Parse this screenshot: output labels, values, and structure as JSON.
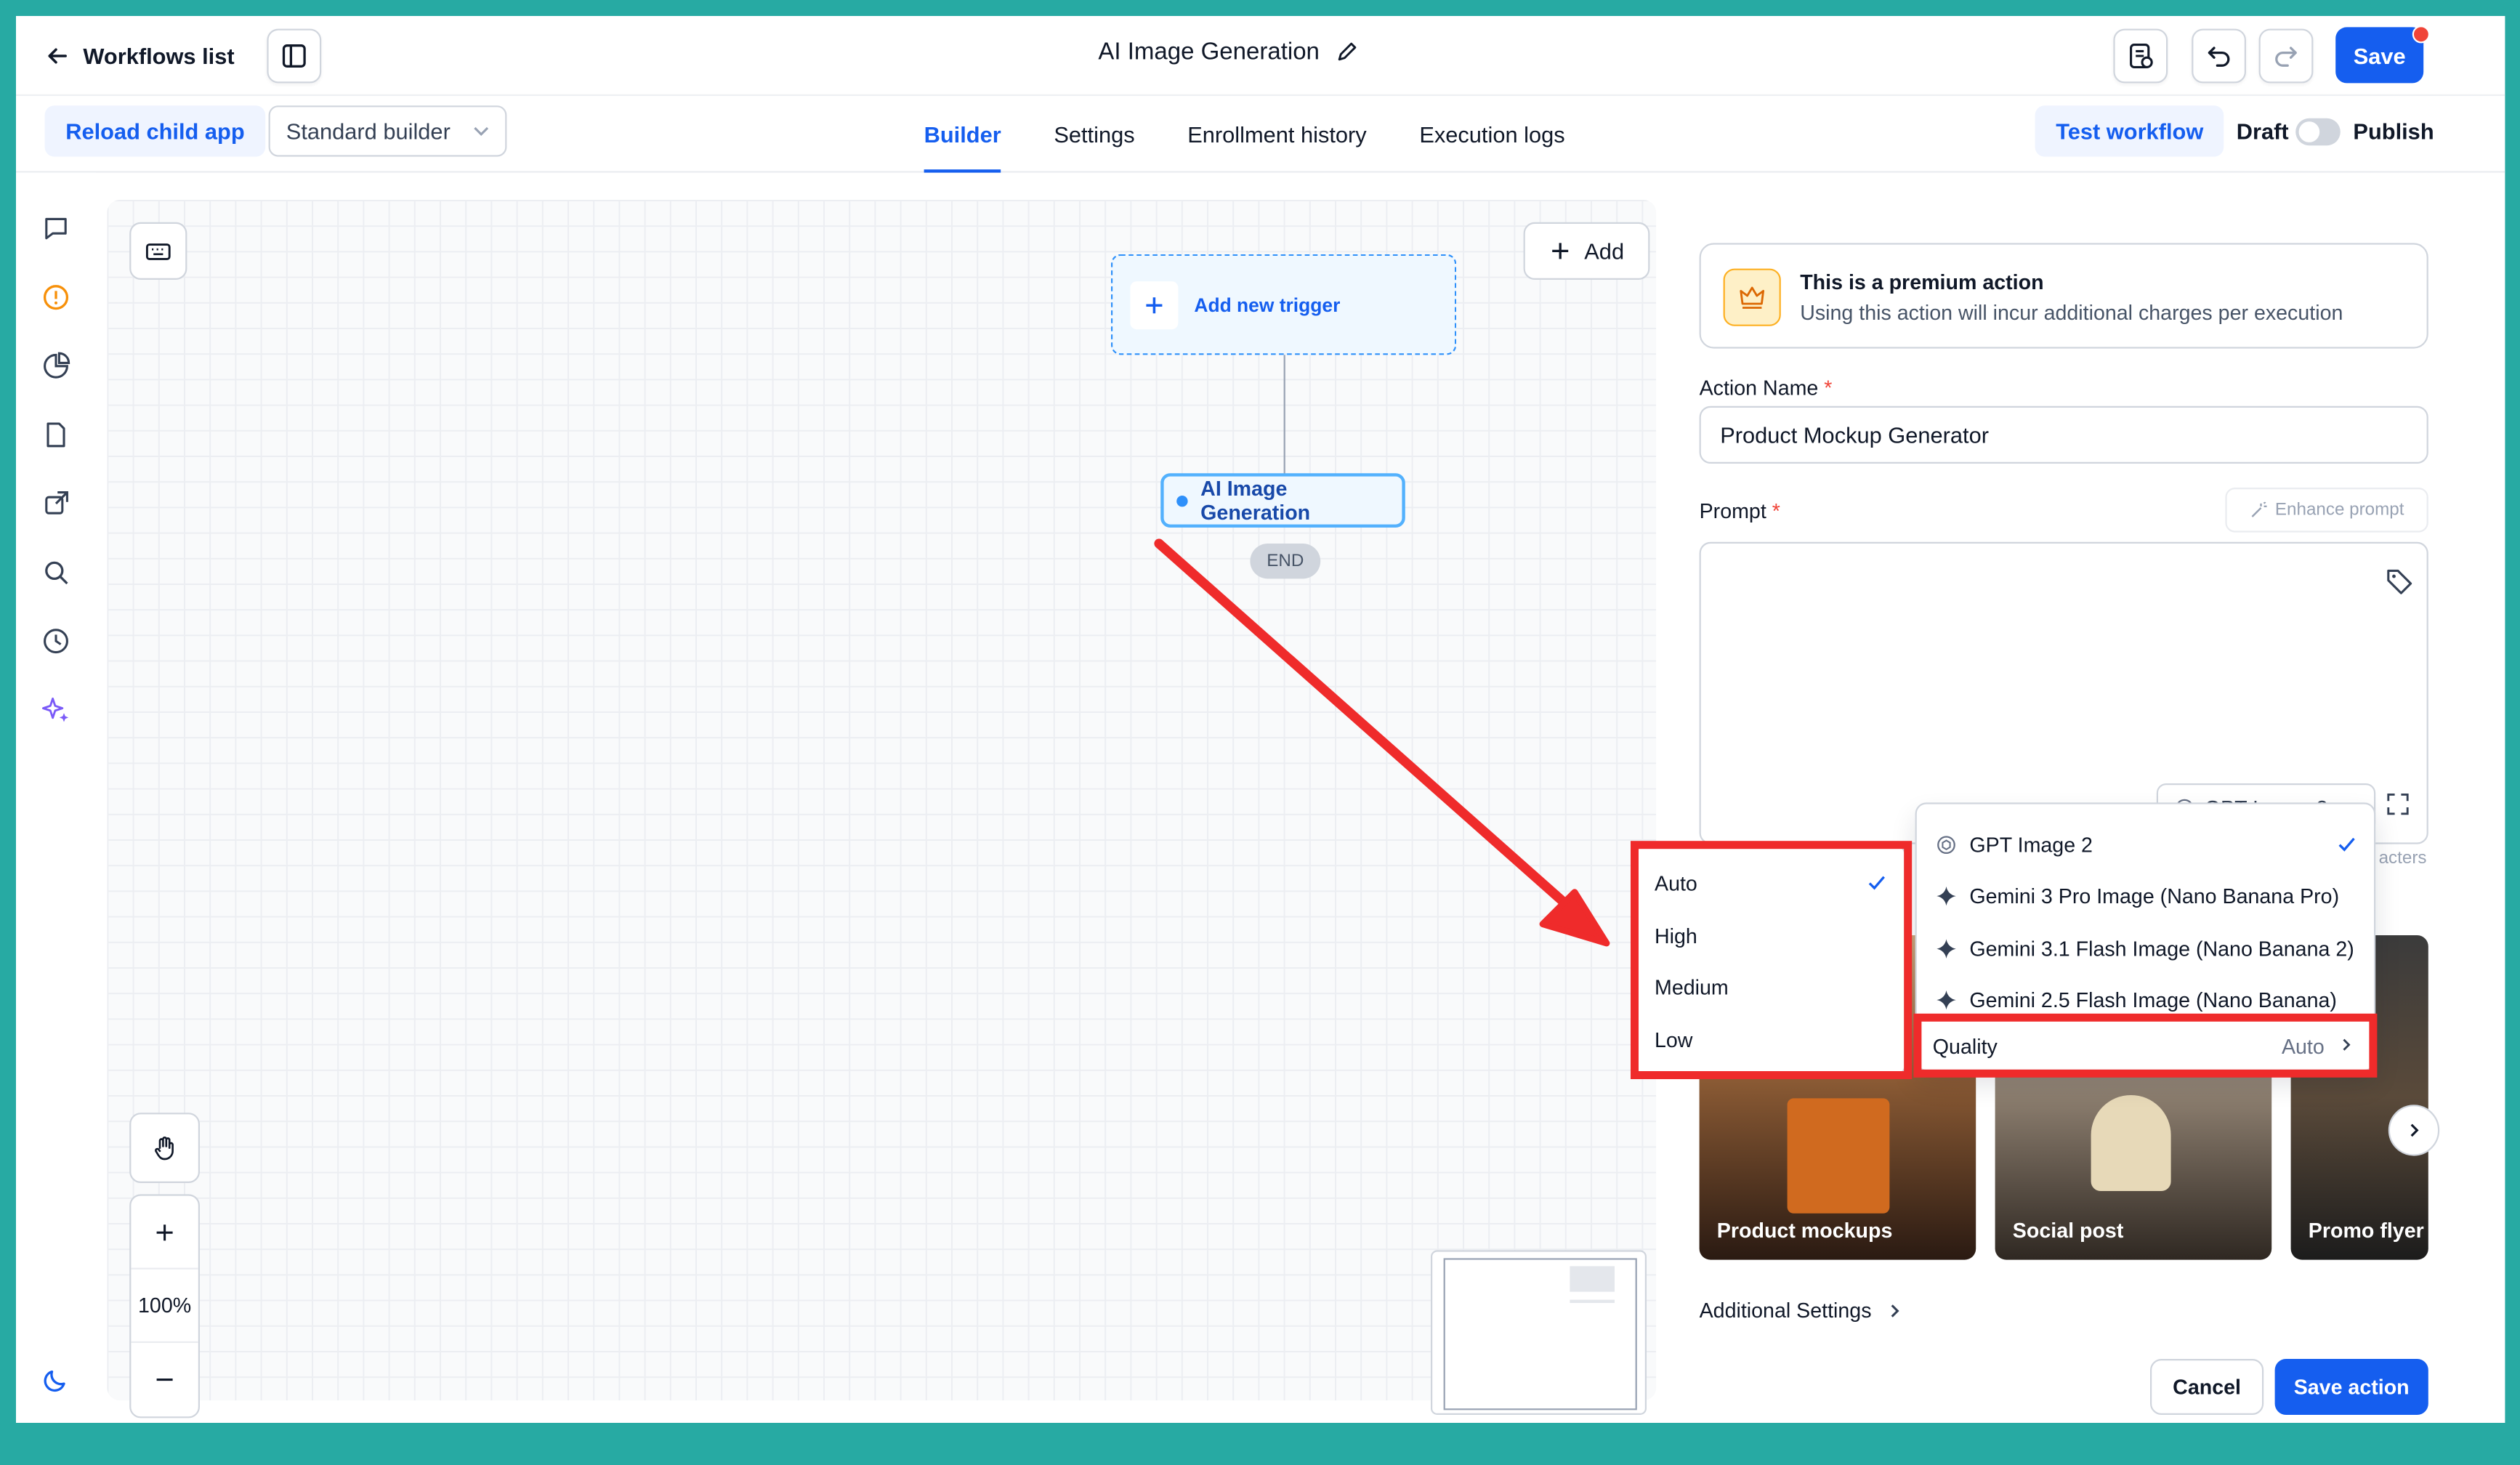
{
  "header": {
    "back_label": "Workflows list",
    "workflow_title": "AI Image Generation",
    "save_label": "Save"
  },
  "subbar": {
    "reload_label": "Reload child app",
    "builder_select_value": "Standard builder",
    "tabs": [
      {
        "label": "Builder",
        "active": true
      },
      {
        "label": "Settings",
        "active": false
      },
      {
        "label": "Enrollment history",
        "active": false
      },
      {
        "label": "Execution logs",
        "active": false
      }
    ],
    "test_label": "Test workflow",
    "draft_label": "Draft",
    "publish_label": "Publish"
  },
  "rail": {
    "icons": [
      "chat-icon",
      "alert-icon",
      "pie-chart-icon",
      "file-icon",
      "external-link-icon",
      "search-icon",
      "history-icon",
      "sparkles-icon"
    ],
    "theme_icon": "moon-icon"
  },
  "canvas": {
    "add_label": "Add",
    "trigger_label": "Add new trigger",
    "node_label": "AI Image Generation",
    "end_label": "END",
    "zoom_level": "100%"
  },
  "panel": {
    "premium_title": "This is a premium action",
    "premium_desc": "Using this action will incur additional charges per execution",
    "action_name_label": "Action Name",
    "action_name_value": "Product Mockup Generator",
    "prompt_label": "Prompt",
    "enhance_label": "Enhance prompt",
    "model_value": "GPT Image 2",
    "chars_text": "acters",
    "templates": [
      {
        "caption": "Product mockups"
      },
      {
        "caption": "Social post"
      },
      {
        "caption": "Promo flyer"
      }
    ],
    "additional_label": "Additional Settings",
    "cancel_label": "Cancel",
    "save_action_label": "Save action"
  },
  "model_menu": {
    "items": [
      {
        "label": "GPT Image 2",
        "selected": true
      },
      {
        "label": "Gemini 3 Pro Image (Nano Banana Pro)",
        "selected": false
      },
      {
        "label": "Gemini 3.1 Flash Image (Nano Banana 2)",
        "selected": false
      },
      {
        "label": "Gemini 2.5 Flash Image (Nano Banana)",
        "selected": false
      }
    ],
    "quality_label": "Quality",
    "quality_value": "Auto"
  },
  "quality_menu": {
    "items": [
      {
        "label": "Auto",
        "selected": true
      },
      {
        "label": "High",
        "selected": false
      },
      {
        "label": "Medium",
        "selected": false
      },
      {
        "label": "Low",
        "selected": false
      }
    ]
  },
  "colors": {
    "accent": "#155eef",
    "annotation_red": "#ef2b2b",
    "frame": "#27aaa3"
  }
}
